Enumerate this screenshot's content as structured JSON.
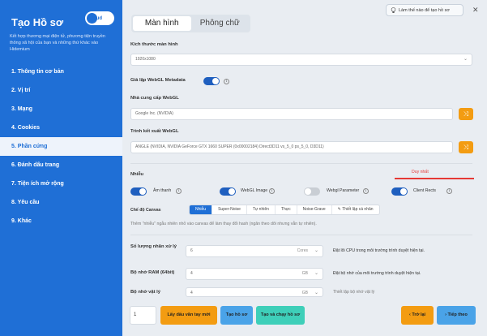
{
  "sidebar": {
    "title": "Tạo Hồ sơ",
    "toggle_label": "Cloud",
    "description": "Kết hợp thương mại điện tử, phương tiện truyền thông xã hội của bạn và những thứ khác vào Hidemium",
    "items": [
      {
        "label": "1. Thông tin cơ bản"
      },
      {
        "label": "2. Vị trí"
      },
      {
        "label": "3. Mạng"
      },
      {
        "label": "4. Cookies"
      },
      {
        "label": "5. Phần cứng"
      },
      {
        "label": "6. Đánh dấu trang"
      },
      {
        "label": "7. Tiện ích mở rộng"
      },
      {
        "label": "8. Yêu cầu"
      },
      {
        "label": "9. Khác"
      }
    ]
  },
  "help": {
    "label": "Làm thế nào để tạo hồ sơ"
  },
  "tabs": [
    {
      "label": "Màn hình"
    },
    {
      "label": "Phông chữ"
    }
  ],
  "screen": {
    "resolution_label": "Kích thước màn hình",
    "resolution_value": "1920x1080",
    "webgl_meta_label": "Giả lập WebGL Metadata",
    "webgl_vendor_label": "Nhà cung cấp WebGL",
    "webgl_vendor_value": "Google Inc. (NVIDIA)",
    "webgl_renderer_label": "Trình kết xuất WebGL",
    "webgl_renderer_value": "ANGLE (NVIDIA, NVIDIA GeForce GTX 1660 SUPER (0x00002184) Direct3D11 vs_5_0 ps_5_0, D3D11)"
  },
  "noise": {
    "label": "Nhiễu",
    "unique_label": "Duy nhất",
    "toggles": [
      {
        "label": "Âm thanh",
        "on": true
      },
      {
        "label": "WebGL Image",
        "on": true
      },
      {
        "label": "Webgl Parameter",
        "on": false
      },
      {
        "label": "Client Rects",
        "on": true
      }
    ],
    "canvas_mode_label": "Chế độ Canvas",
    "canvas_modes": [
      "Nhiễu",
      "Super-Noise",
      "Tự nhiên",
      "Thực",
      "Noise-Grave"
    ],
    "canvas_mode_selected": "Nhiễu",
    "custom_label": "Thiết lập cá nhân",
    "hint": "Thêm \"nhiễu\" ngẫu nhiên nhỏ vào canvas để làm thay đổi hash (ngăn theo dõi nhưng vẫn tự nhiên)."
  },
  "hardware": {
    "cpu_label": "Số lượng nhân xử lý",
    "cpu_value": "6",
    "cpu_unit": "Cores",
    "cpu_desc": "Đặt lõi CPU trong môi trường trình duyệt hiện tại.",
    "ram_label": "Bộ nhớ RAM (64bit)",
    "ram_value": "4",
    "ram_unit": "GB",
    "ram_desc": "Đặt bộ nhớ của môi trường trình duyệt hiện tại.",
    "vram_label": "Bộ nhớ vật lý",
    "vram_value": "4",
    "vram_unit": "GB",
    "vram_desc": "Thiết lập bộ nhớ vật lý"
  },
  "footer": {
    "count": "1",
    "fingerprint_label": "Lấy dấu vân tay mới",
    "create_label": "Tạo hồ sơ",
    "create_run_label": "Tạo và chạy hồ sơ",
    "back_label": "Trở lại",
    "next_label": "Tiếp theo"
  },
  "colors": {
    "primary": "#1f6fd6",
    "orange": "#f39c12",
    "teal": "#3ecfb9",
    "red_accent": "#e53935"
  }
}
